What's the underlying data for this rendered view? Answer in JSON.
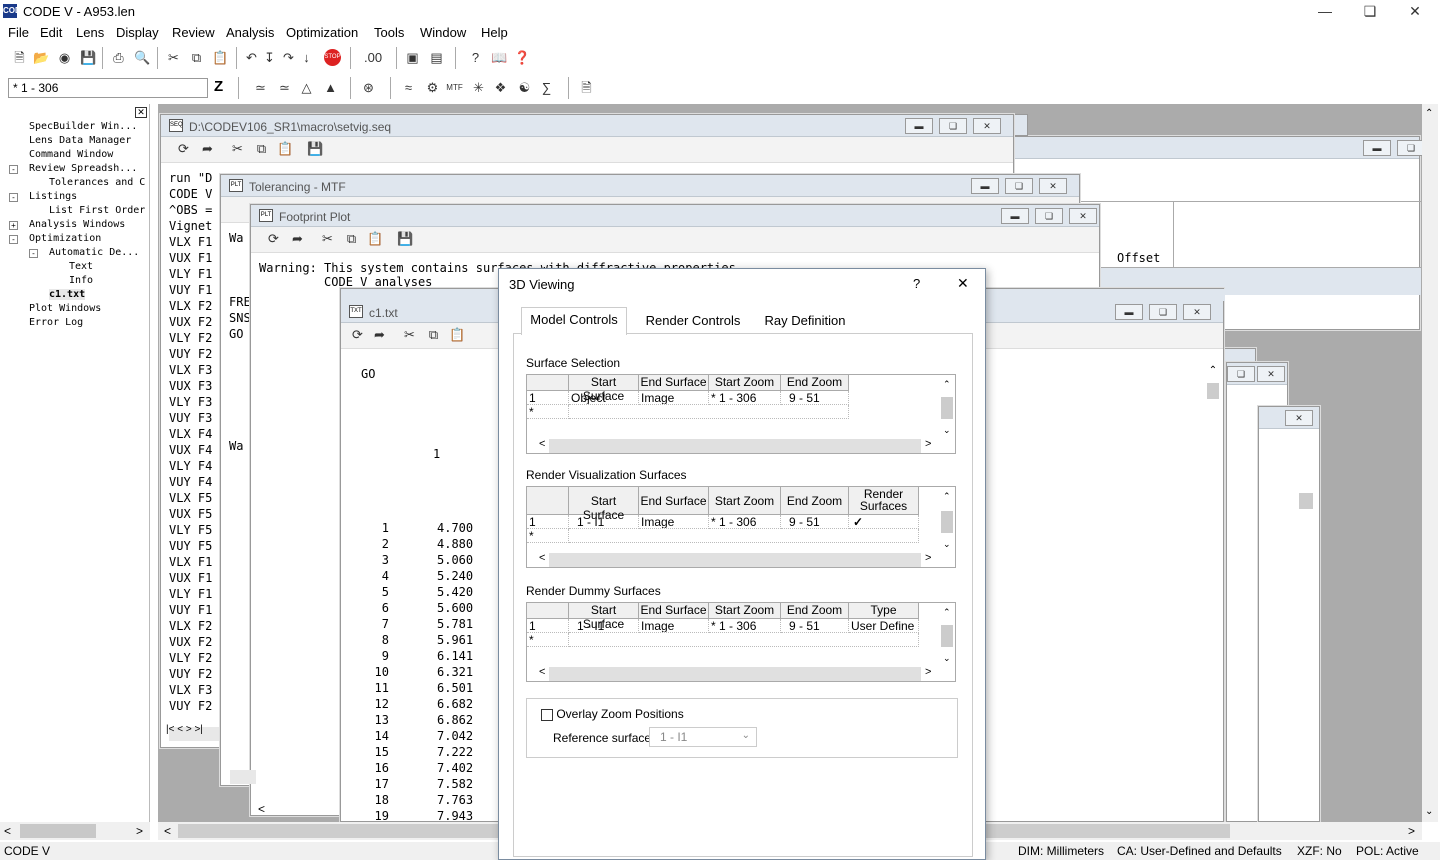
{
  "app": {
    "title": "CODE V - A953.len",
    "icon_label": "CODE"
  },
  "menu": [
    "File",
    "Edit",
    "Lens",
    "Display",
    "Review",
    "Analysis",
    "Optimization",
    "Tools",
    "Window",
    "Help"
  ],
  "toolbar": {
    "zoom_select": "* 1 - 306",
    "z_label": "Z",
    "stop_label": "STOP"
  },
  "tree": {
    "items": [
      "SpecBuilder Win...",
      "Lens Data Manager",
      "Command Window",
      "Review Spreadsh...",
      "Tolerances and C",
      "Listings",
      "List First Order",
      "Analysis Windows",
      "Optimization",
      "Automatic De...",
      "Text",
      "Info",
      "c1.txt",
      "Plot Windows",
      "Error Log"
    ]
  },
  "windows": {
    "setvig": {
      "title": "D:\\CODEV106_SR1\\macro\\setvig.seq",
      "lines": [
        "run \"D",
        "CODE V",
        "^OBS =",
        "Vignet",
        "VLX F1",
        "VUX F1",
        "VLY F1",
        "VUY F1",
        "VLX F2",
        "VUX F2",
        "VLY F2",
        "VUY F2",
        "VLX F3",
        "VUX F3",
        "VLY F3",
        "VUY F3",
        "VLX F4",
        "VUX F4",
        "VLY F4",
        "VUY F4",
        "VLX F5",
        "VUX F5",
        "VLY F5",
        "VUY F5",
        "VLX F1",
        "VUX F1",
        "VLY F1",
        "VUY F1",
        "VLX F2",
        "VUX F2",
        "VLY F2",
        "VUY F2",
        "VLX F3",
        "VUY F2"
      ]
    },
    "tolerancing": {
      "title": "Tolerancing - MTF",
      "lines": [
        "Wa",
        "FRE",
        "SNS",
        "GO",
        "Wa"
      ]
    },
    "footprint": {
      "title": "Footprint Plot",
      "warning1": "Warning: This system contains surfaces with diffractive properties.",
      "warning2": "         CODE V analyses"
    },
    "c1": {
      "title": "c1.txt",
      "go": "GO",
      "one": "1",
      "rows": [
        [
          "1",
          "4.700"
        ],
        [
          "2",
          "4.880"
        ],
        [
          "3",
          "5.060"
        ],
        [
          "4",
          "5.240"
        ],
        [
          "5",
          "5.420"
        ],
        [
          "6",
          "5.600"
        ],
        [
          "7",
          "5.781"
        ],
        [
          "8",
          "5.961"
        ],
        [
          "9",
          "6.141"
        ],
        [
          "10",
          "6.321"
        ],
        [
          "11",
          "6.501"
        ],
        [
          "12",
          "6.682"
        ],
        [
          "13",
          "6.862"
        ],
        [
          "14",
          "7.042"
        ],
        [
          "15",
          "7.222"
        ],
        [
          "16",
          "7.402"
        ],
        [
          "17",
          "7.582"
        ],
        [
          "18",
          "7.763"
        ],
        [
          "19",
          "7.943"
        ]
      ]
    },
    "spreadsheet": {
      "offset_label": "Offset"
    }
  },
  "dialog": {
    "title": "3D Viewing",
    "help": "?",
    "close": "✕",
    "tabs": [
      "Model Controls",
      "Render Controls",
      "Ray Definition"
    ],
    "surface_selection": {
      "label": "Surface Selection",
      "headers": [
        "Start Surface",
        "End Surface",
        "Start Zoom",
        "End Zoom"
      ],
      "rows": [
        [
          "1",
          "Object",
          "Image",
          "* 1 - 306",
          "9 - 51"
        ],
        [
          "*",
          "",
          "",
          "",
          ""
        ]
      ]
    },
    "render_vis": {
      "label": "Render Visualization Surfaces",
      "headers": [
        "Start Surface",
        "End Surface",
        "Start Zoom",
        "End Zoom",
        "Render Surfaces"
      ],
      "rows": [
        [
          "1",
          "1 - I1",
          "Image",
          "* 1 - 306",
          "9 - 51",
          "✓"
        ],
        [
          "*",
          "",
          "",
          "",
          "",
          ""
        ]
      ]
    },
    "render_dummy": {
      "label": "Render Dummy Surfaces",
      "headers": [
        "Start Surface",
        "End Surface",
        "Start Zoom",
        "End Zoom",
        "Type"
      ],
      "rows": [
        [
          "1",
          "1 - I1",
          "Image",
          "* 1 - 306",
          "9 - 51",
          "User Define"
        ],
        [
          "*",
          "",
          "",
          "",
          "",
          ""
        ]
      ]
    },
    "overlay": {
      "label": "Overlay Zoom Positions",
      "ref_label": "Reference surface",
      "ref_value": "1 - I1"
    }
  },
  "status": {
    "left": "CODE V",
    "dim": "DIM: Millimeters",
    "ca": "CA: User-Defined and Defaults",
    "xzf": "XZF: No",
    "pol": "POL: Active"
  }
}
